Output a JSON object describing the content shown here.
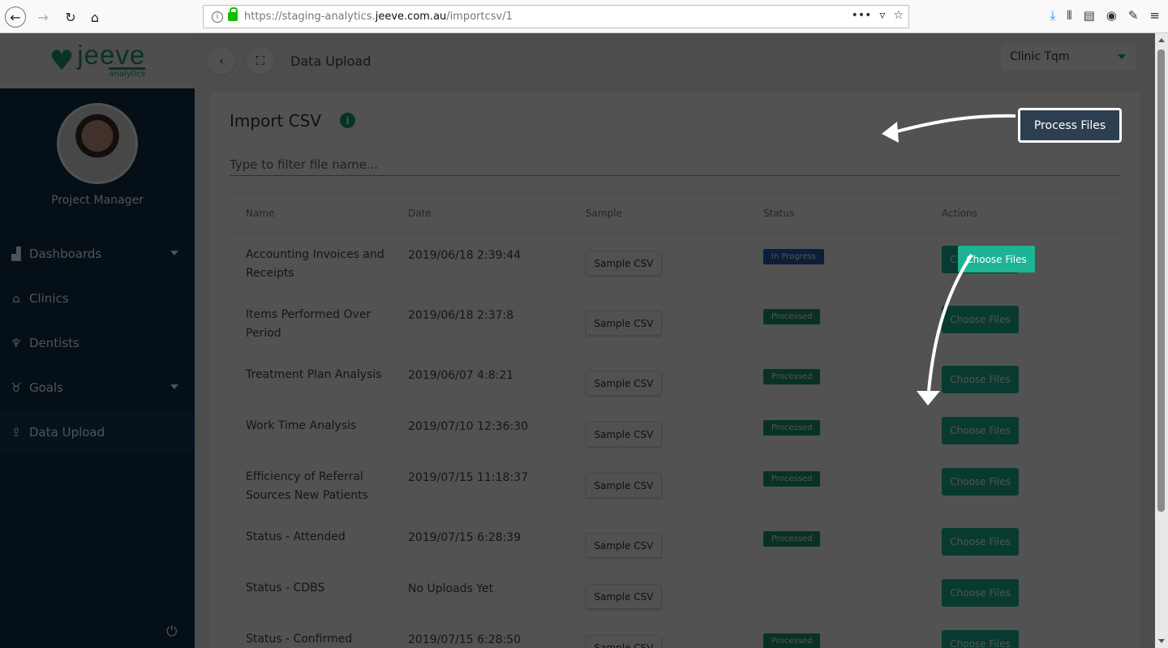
{
  "browser": {
    "url_prefix": "https://staging-analytics.",
    "url_host": "jeeve.com.au",
    "url_path": "/importcsv/1",
    "page_actions": "•••",
    "pocket_icon": "pocket-icon",
    "bookmark_icon": "star-icon"
  },
  "brand": {
    "name": "jeeve",
    "sub": "analytics"
  },
  "user": {
    "role": "Project Manager"
  },
  "sidebar": {
    "items": [
      {
        "label": "Dashboards",
        "icon": "chart-icon",
        "has_chevron": true
      },
      {
        "label": "Clinics",
        "icon": "home-icon",
        "has_chevron": false
      },
      {
        "label": "Dentists",
        "icon": "tooth-icon",
        "has_chevron": false
      },
      {
        "label": "Goals",
        "icon": "medal-icon",
        "has_chevron": true
      },
      {
        "label": "Data Upload",
        "icon": "upload-icon",
        "has_chevron": false,
        "active": true
      }
    ]
  },
  "header": {
    "title": "Data Upload",
    "clinic": "Clinic Tqm"
  },
  "card": {
    "title": "Import CSV",
    "process_label": "Process Files",
    "filter_placeholder": "Type to filter file name..."
  },
  "table": {
    "headers": [
      "Name",
      "Date",
      "Sample",
      "Status",
      "Actions"
    ],
    "sample_label": "Sample CSV",
    "choose_label": "Choose Files",
    "rows": [
      {
        "name_l1": "Accounting Invoices and",
        "name_l2": "Receipts",
        "date": "2019/06/18 2:39:44",
        "status": "In Progress"
      },
      {
        "name_l1": "Items Performed Over",
        "name_l2": "Period",
        "date": "2019/06/18 2:37:8",
        "status": "Processed"
      },
      {
        "name_l1": "Treatment Plan Analysis",
        "name_l2": "",
        "date": "2019/06/07 4:8:21",
        "status": "Processed"
      },
      {
        "name_l1": "Work Time Analysis",
        "name_l2": "",
        "date": "2019/07/10 12:36:30",
        "status": "Processed"
      },
      {
        "name_l1": "Efficiency of Referral",
        "name_l2": "Sources New Patients",
        "date": "2019/07/15 11:18:37",
        "status": "Processed"
      },
      {
        "name_l1": "Status - Attended",
        "name_l2": "",
        "date": "2019/07/15 6:28:39",
        "status": "Processed"
      },
      {
        "name_l1": "Status - CDBS",
        "name_l2": "",
        "date": "No Uploads Yet",
        "status": ""
      },
      {
        "name_l1": "Status - Confirmed",
        "name_l2": "",
        "date": "2019/07/15 6:28:50",
        "status": "Processed"
      }
    ]
  },
  "colors": {
    "sidebar_bg": "#0d2f4a",
    "accent": "#1c9c7a",
    "process_btn": "#2d3e50",
    "in_progress": "#2a5db0"
  }
}
